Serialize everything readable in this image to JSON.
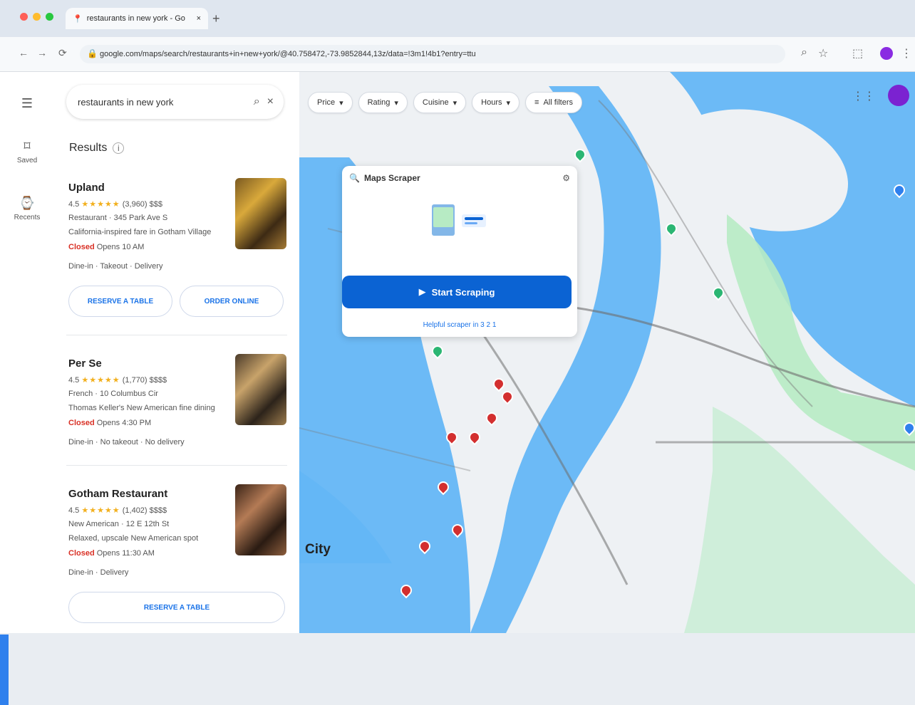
{
  "browser": {
    "tab_title": "restaurants in new york - Go",
    "address": "google.com/maps/search/restaurants+in+new+york/@40.758472,-73.9852844,13z/data=!3m1!4b1?entry=ttu"
  },
  "search": {
    "value": "restaurants in new york"
  },
  "left_rail": [
    {
      "label": "Saved",
      "icon": "bookmark-icon"
    },
    {
      "label": "Recents",
      "icon": "history-icon"
    }
  ],
  "results": {
    "title": "Results",
    "items": [
      {
        "name": "Upland",
        "rating": "4.5",
        "reviews": "(3,960)",
        "price": "$$$",
        "meta": "Restaurant · 345 Park Ave S",
        "desc": "California-inspired fare in Gotham Village",
        "status_closed": "Closed",
        "status_open": "Opens 10 AM",
        "services": "Dine-in · Takeout · Delivery",
        "btn1": "RESERVE A TABLE",
        "btn2": "ORDER ONLINE"
      },
      {
        "name": "Per Se",
        "rating": "4.5",
        "reviews": "(1,770)",
        "price": "$$$$",
        "meta": "French · 10 Columbus Cir",
        "desc": "Thomas Keller's New American fine dining",
        "status_closed": "Closed",
        "status_open": "Opens 4:30 PM",
        "services": "Dine-in · No takeout · No delivery",
        "btn1": "",
        "btn2": ""
      },
      {
        "name": "Gotham Restaurant",
        "rating": "4.5",
        "reviews": "(1,402)",
        "price": "$$$$",
        "meta": "New American · 12 E 12th St",
        "desc": "Relaxed, upscale New American spot",
        "status_closed": "Closed",
        "status_open": "Opens 11:30 AM",
        "services": "Dine-in · Delivery",
        "btn1": "RESERVE A TABLE",
        "btn2": ""
      }
    ]
  },
  "filters": [
    "Price",
    "Rating",
    "Cuisine",
    "Hours",
    "All filters"
  ],
  "overlay": {
    "title": "Maps Scraper",
    "cta": "Start Scraping",
    "link": "Helpful scraper in 3 2 1"
  },
  "map_labels": {
    "city": "City"
  },
  "colors": {
    "water": "#64b6f5",
    "park": "#b7ebc4",
    "accent": "#0b63d3",
    "marker": "#d32f2f"
  }
}
